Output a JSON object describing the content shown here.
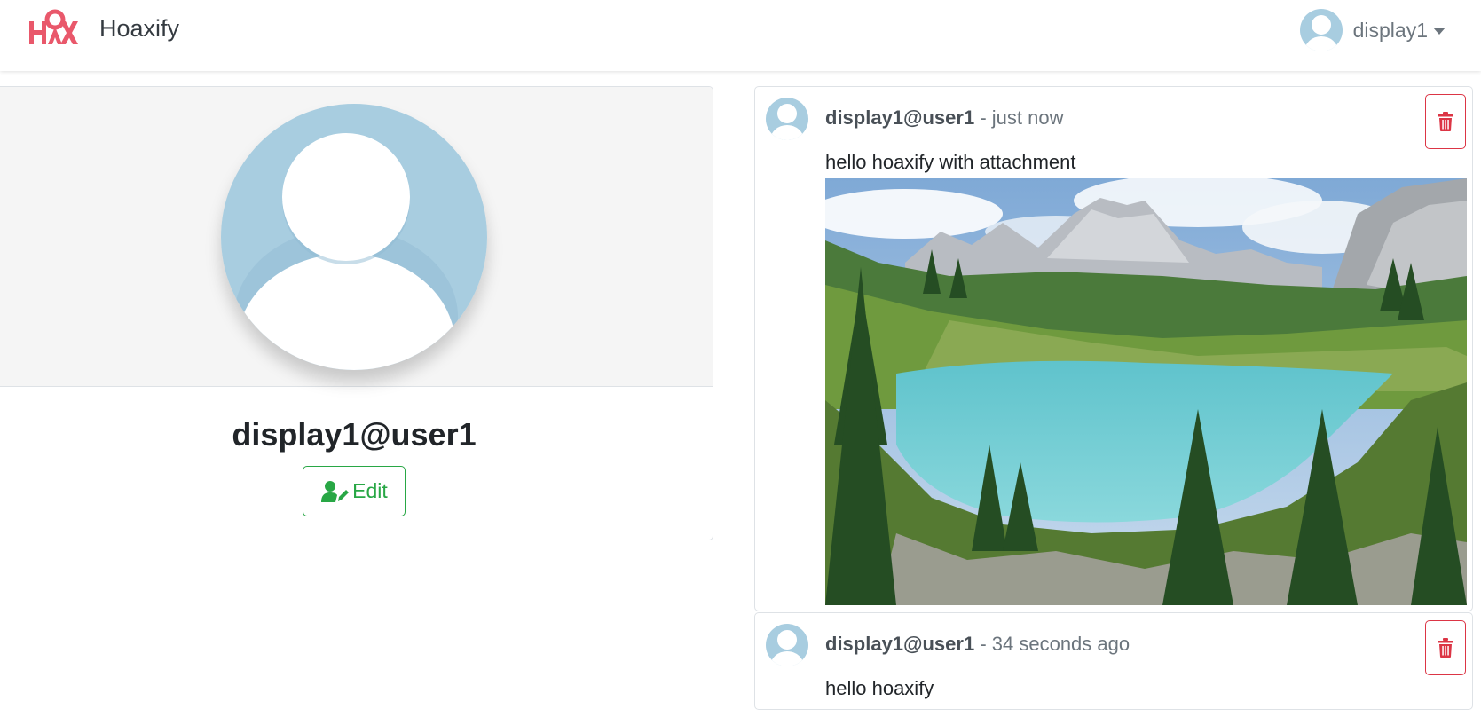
{
  "navbar": {
    "brand_name": "Hoaxify",
    "user_display": "display1"
  },
  "profile": {
    "username": "display1@user1",
    "edit_label": "Edit"
  },
  "hoaxes": [
    {
      "user": "display1@user1",
      "separator": " - ",
      "time": "just now",
      "content": "hello hoaxify with attachment",
      "has_attachment": true
    },
    {
      "user": "display1@user1",
      "separator": " - ",
      "time": "34 seconds ago",
      "content": "hello hoaxify",
      "has_attachment": false
    }
  ],
  "colors": {
    "success": "#28a745",
    "danger": "#dc3545",
    "avatar_bg": "#a8cde0",
    "logo": "#e84a5f"
  },
  "icons": {
    "brand_logo": "hoaxify-logo",
    "edit": "user-edit-icon",
    "delete": "trash-icon",
    "caret": "caret-down-icon"
  }
}
